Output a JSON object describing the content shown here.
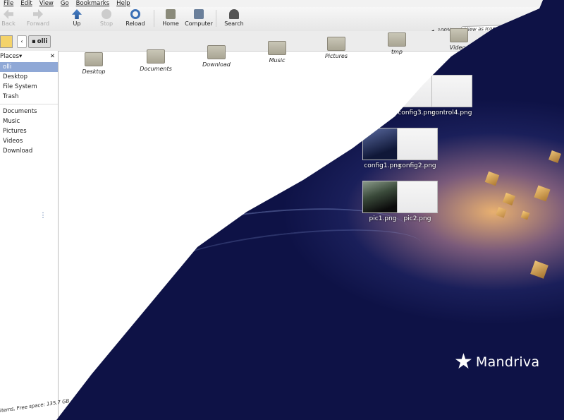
{
  "menu": [
    "File",
    "Edit",
    "View",
    "Go",
    "Bookmarks",
    "Help"
  ],
  "toolbar": {
    "back": "Back",
    "forward": "Forward",
    "up": "Up",
    "stop": "Stop",
    "reload": "Reload",
    "home": "Home",
    "computer": "Computer",
    "search": "Search"
  },
  "zoom": {
    "level": "100%",
    "view_as": "View as Icons"
  },
  "location": {
    "current": "olli"
  },
  "sidebar": {
    "header": "Places",
    "items": [
      "olli",
      "Desktop",
      "File System",
      "Trash",
      "Documents",
      "Music",
      "Pictures",
      "Videos",
      "Download"
    ]
  },
  "folders": [
    "Desktop",
    "Documents",
    "Download",
    "Music",
    "Pictures",
    "tmp",
    "Videos"
  ],
  "status": "items, Free space: 135.7 GB",
  "desktop_icons": [
    "config3.png",
    "control4.png",
    "config1.png",
    "config2.png",
    "pic1.png",
    "pic2.png"
  ],
  "logo_text": "Mandriva"
}
